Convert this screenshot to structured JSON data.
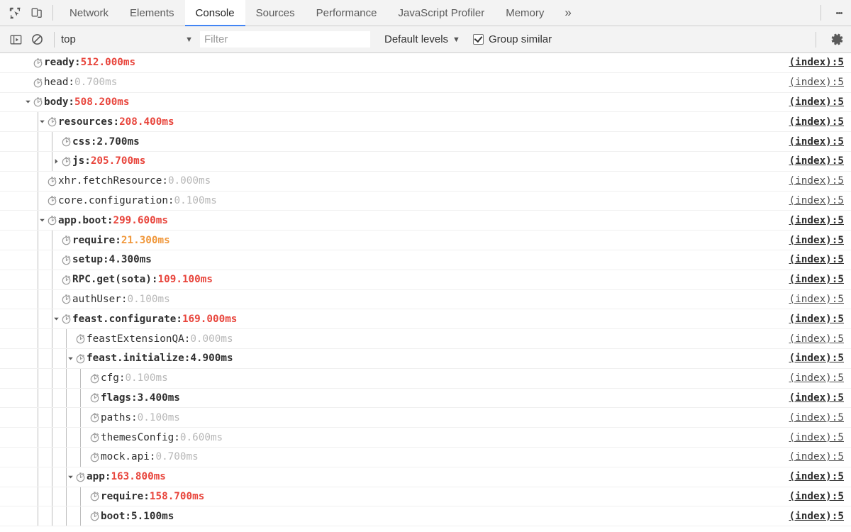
{
  "window": {
    "app": "Chrome DevTools",
    "accent_color": "#4285f4",
    "toolbar_bg": "#f3f3f3"
  },
  "tabbar": {
    "inspect_icon": "inspect-cursor-icon",
    "device_icon": "device-toolbar-icon",
    "tabs": [
      {
        "label": "Network",
        "selected": false
      },
      {
        "label": "Elements",
        "selected": false
      },
      {
        "label": "Console",
        "selected": true
      },
      {
        "label": "Sources",
        "selected": false
      },
      {
        "label": "Performance",
        "selected": false
      },
      {
        "label": "JavaScript Profiler",
        "selected": false
      },
      {
        "label": "Memory",
        "selected": false
      }
    ],
    "more_label": "»",
    "kebab_icon": "more-options-icon"
  },
  "filterbar": {
    "sidebar_toggle_icon": "console-sidebar-icon",
    "clear_console_icon": "clear-console-icon",
    "context": {
      "value": "top",
      "caret": "▼"
    },
    "filter": {
      "value": "",
      "placeholder": "Filter"
    },
    "levels": {
      "label": "Default levels",
      "caret": "▼"
    },
    "group_similar": {
      "label": "Group similar",
      "checked": true
    },
    "settings_icon": "gear-icon"
  },
  "colors": {
    "red": "#e8453c",
    "orange": "#f0983c",
    "dark": "#303030",
    "grey": "#b7b7b7"
  },
  "console": {
    "source_link": "(index):5",
    "rows": [
      {
        "depth": 0,
        "arrow": "none",
        "label": "ready",
        "value": "512.000ms",
        "color": "red",
        "bold": true
      },
      {
        "depth": 0,
        "arrow": "none",
        "label": "head",
        "value": "0.700ms",
        "color": "grey",
        "bold": false
      },
      {
        "depth": 0,
        "arrow": "open",
        "label": "body",
        "value": "508.200ms",
        "color": "red",
        "bold": true
      },
      {
        "depth": 1,
        "arrow": "open",
        "label": "resources",
        "value": "208.400ms",
        "color": "red",
        "bold": true
      },
      {
        "depth": 2,
        "arrow": "none",
        "label": "css",
        "value": "2.700ms",
        "color": "dark",
        "bold": true
      },
      {
        "depth": 2,
        "arrow": "closed",
        "label": "js",
        "value": "205.700ms",
        "color": "red",
        "bold": true
      },
      {
        "depth": 1,
        "arrow": "none",
        "label": "xhr.fetchResource",
        "value": "0.000ms",
        "color": "grey",
        "bold": false
      },
      {
        "depth": 1,
        "arrow": "none",
        "label": "core.configuration",
        "value": "0.100ms",
        "color": "grey",
        "bold": false
      },
      {
        "depth": 1,
        "arrow": "open",
        "label": "app.boot",
        "value": "299.600ms",
        "color": "red",
        "bold": true
      },
      {
        "depth": 2,
        "arrow": "none",
        "label": "require",
        "value": "21.300ms",
        "color": "orange",
        "bold": true
      },
      {
        "depth": 2,
        "arrow": "none",
        "label": "setup",
        "value": "4.300ms",
        "color": "dark",
        "bold": true
      },
      {
        "depth": 2,
        "arrow": "none",
        "label": "RPC.get(sota)",
        "value": "109.100ms",
        "color": "red",
        "bold": true
      },
      {
        "depth": 2,
        "arrow": "none",
        "label": "authUser",
        "value": "0.100ms",
        "color": "grey",
        "bold": false
      },
      {
        "depth": 2,
        "arrow": "open",
        "label": "feast.configurate",
        "value": "169.000ms",
        "color": "red",
        "bold": true
      },
      {
        "depth": 3,
        "arrow": "none",
        "label": "feastExtensionQA",
        "value": "0.000ms",
        "color": "grey",
        "bold": false
      },
      {
        "depth": 3,
        "arrow": "open",
        "label": "feast.initialize",
        "value": "4.900ms",
        "color": "dark",
        "bold": true
      },
      {
        "depth": 4,
        "arrow": "none",
        "label": "cfg",
        "value": "0.100ms",
        "color": "grey",
        "bold": false
      },
      {
        "depth": 4,
        "arrow": "none",
        "label": "flags",
        "value": "3.400ms",
        "color": "dark",
        "bold": true
      },
      {
        "depth": 4,
        "arrow": "none",
        "label": "paths",
        "value": "0.100ms",
        "color": "grey",
        "bold": false
      },
      {
        "depth": 4,
        "arrow": "none",
        "label": "themesConfig",
        "value": "0.600ms",
        "color": "grey",
        "bold": false
      },
      {
        "depth": 4,
        "arrow": "none",
        "label": "mock.api",
        "value": "0.700ms",
        "color": "grey",
        "bold": false
      },
      {
        "depth": 3,
        "arrow": "open",
        "label": "app",
        "value": "163.800ms",
        "color": "red",
        "bold": true
      },
      {
        "depth": 4,
        "arrow": "none",
        "label": "require",
        "value": "158.700ms",
        "color": "red",
        "bold": true
      },
      {
        "depth": 4,
        "arrow": "none",
        "label": "boot",
        "value": "5.100ms",
        "color": "dark",
        "bold": true
      }
    ]
  }
}
